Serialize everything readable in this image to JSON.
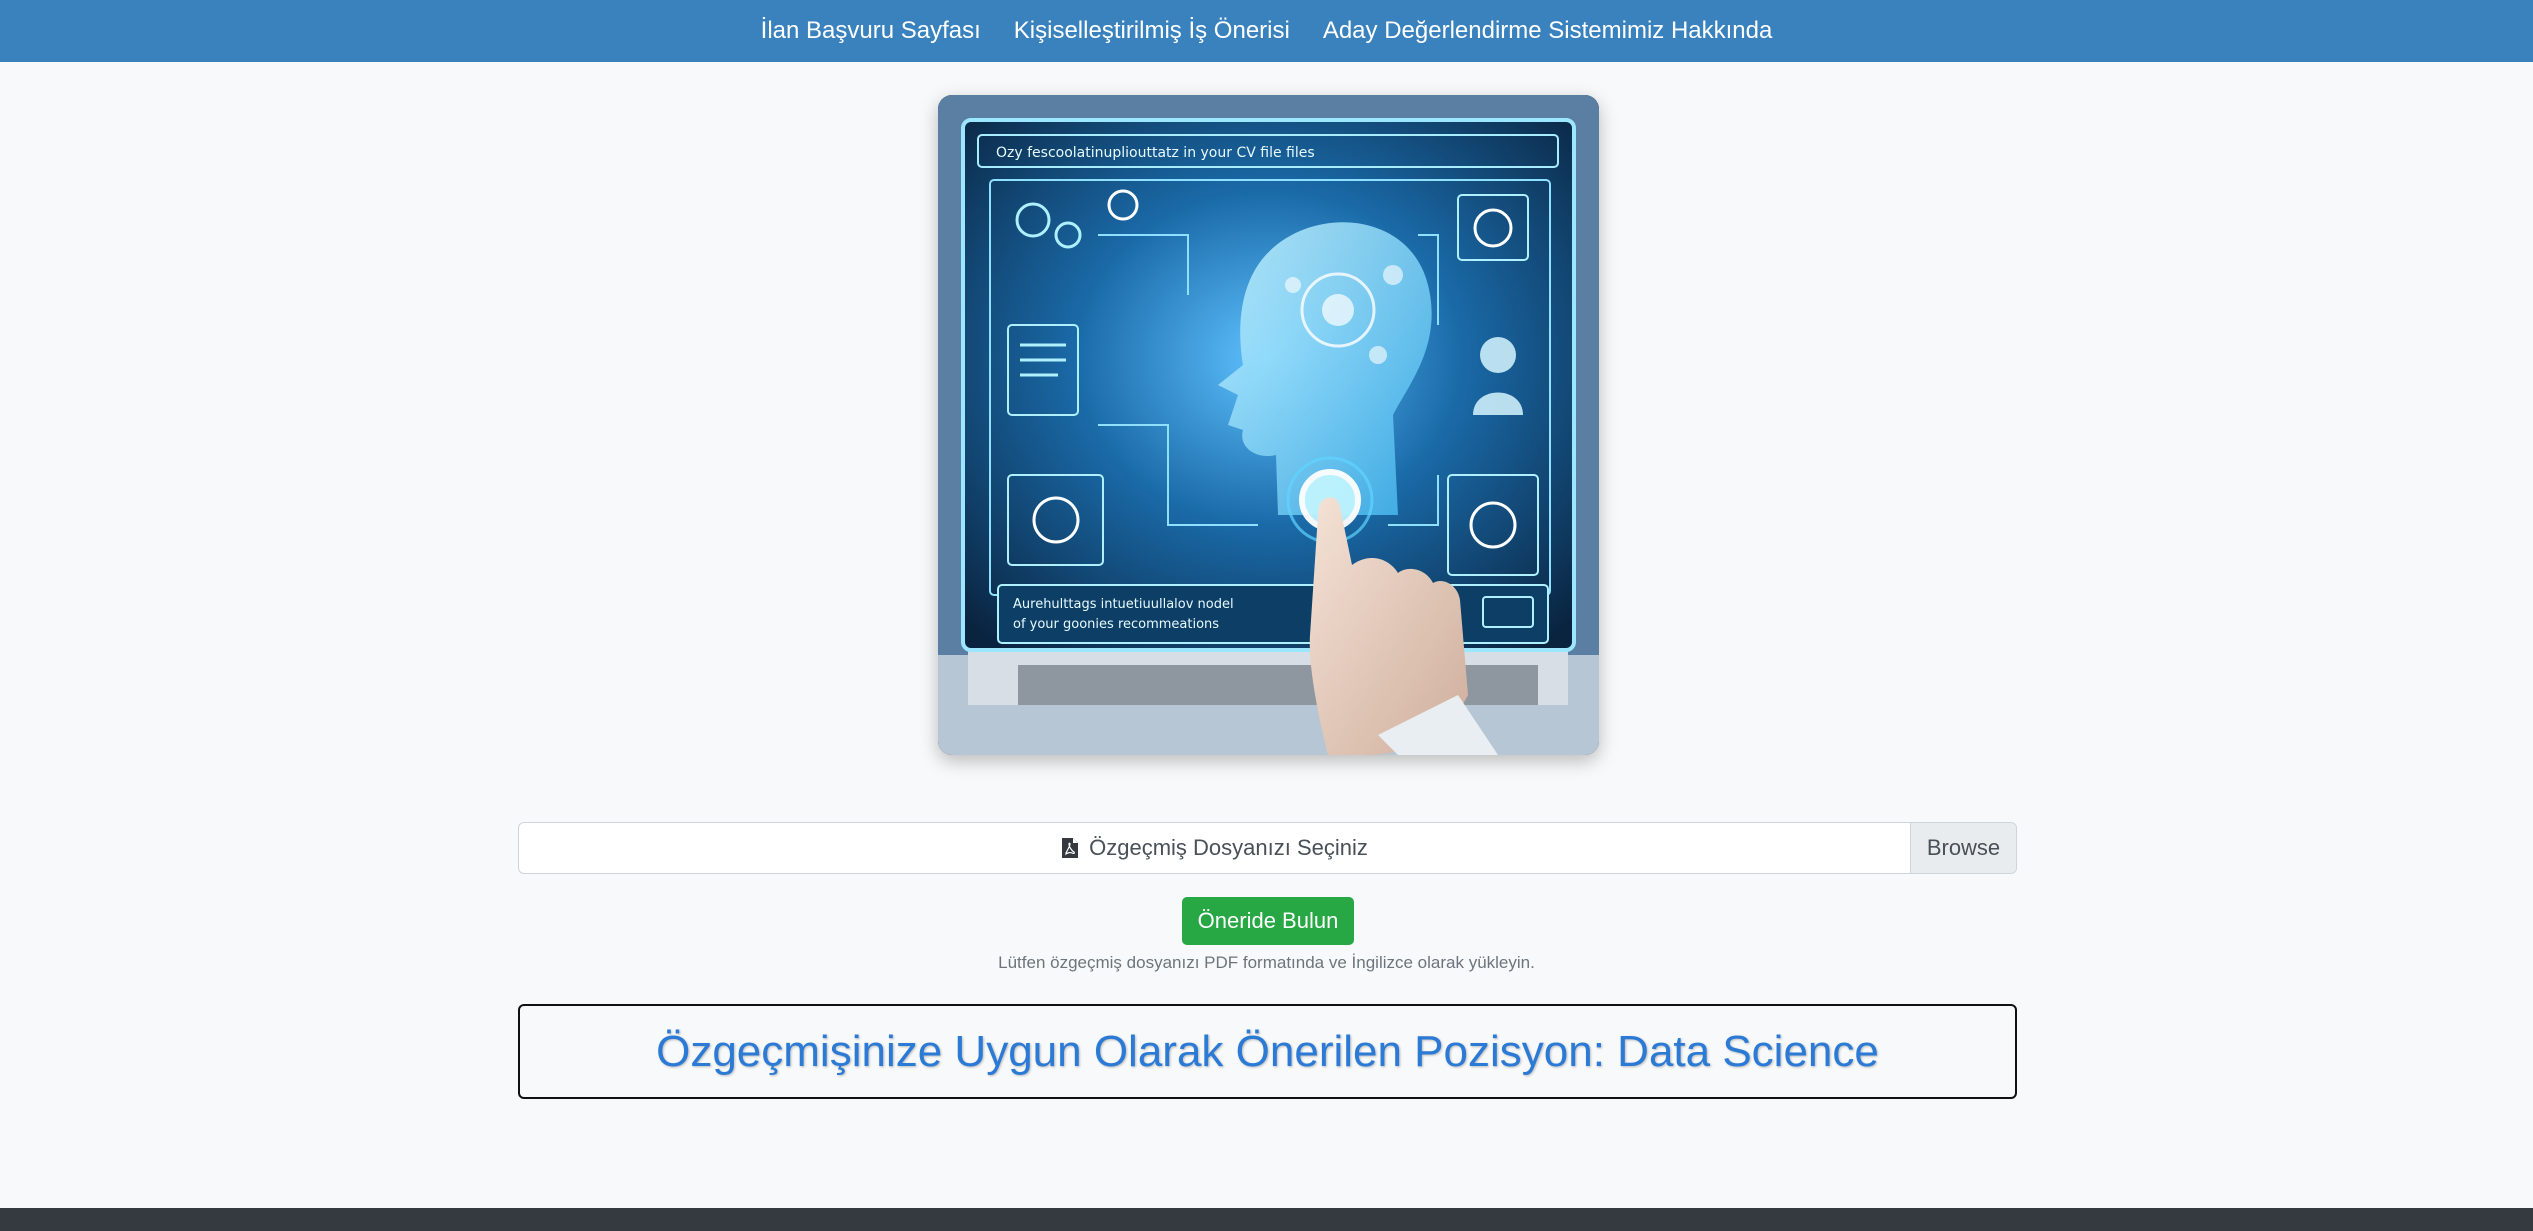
{
  "nav": {
    "items": [
      {
        "label": "İlan Başvuru Sayfası"
      },
      {
        "label": "Kişiselleştirilmiş İş Önerisi"
      },
      {
        "label": "Aday Değerlendirme Sistemimiz Hakkında"
      }
    ]
  },
  "hero": {
    "image_desc": "AI head hologram on laptop screen with finger tapping",
    "screen_top_text": "Ozy fescoolatinupliouttatz in your CV file files",
    "screen_bottom_text_1": "Aurehulttags intuetiuullalov nodel",
    "screen_bottom_text_2": "of your goonies recommeations"
  },
  "upload": {
    "label": "Özgeçmiş Dosyanızı Seçiniz",
    "browse_label": "Browse",
    "icon": "file-pdf-icon"
  },
  "submit": {
    "label": "Öneride Bulun"
  },
  "hint": {
    "text": "Lütfen özgeçmiş dosyanızı PDF formatında ve İngilizce olarak yükleyin."
  },
  "result": {
    "text": "Özgeçmişinize Uygun Olarak Önerilen Pozisyon: Data Science"
  },
  "colors": {
    "navbar": "#3a82be",
    "submit": "#28a745",
    "result_text": "#2a7ad6",
    "footer": "#343a40"
  }
}
